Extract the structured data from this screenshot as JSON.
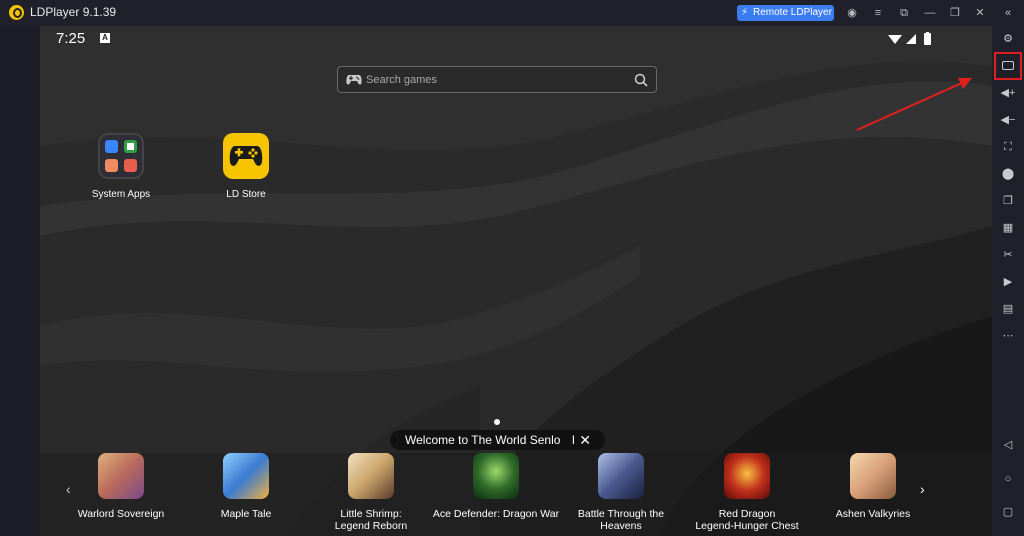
{
  "titlebar": {
    "app_title": "LDPlayer 9.1.39",
    "remote_button": "Remote LDPlayer",
    "icons": [
      "account-icon",
      "menu-icon",
      "fullscreen-icon",
      "minimize-icon",
      "restore-icon",
      "close-icon",
      "collapse-icon"
    ]
  },
  "statusbar": {
    "time": "7:25",
    "notification": "A"
  },
  "search": {
    "placeholder": "Search games"
  },
  "desktop": {
    "apps": [
      {
        "label": "System Apps"
      },
      {
        "label": "LD Store"
      }
    ]
  },
  "toast": {
    "text": "Welcome to The World Senlo",
    "cursor": "I"
  },
  "dock": {
    "games": [
      {
        "line1": "Warlord Sovereign",
        "line2": "",
        "color": "#b86a5a"
      },
      {
        "line1": "Maple Tale",
        "line2": "",
        "color": "#3a7bd0"
      },
      {
        "line1": "Little Shrimp:",
        "line2": "Legend Reborn",
        "color": "#c9a46a"
      },
      {
        "line1": "Ace Defender: Dragon War",
        "line2": "",
        "color": "#2f6a2a"
      },
      {
        "line1": "Battle Through the",
        "line2": "Heavens",
        "color": "#4a5a90"
      },
      {
        "line1": "Red Dragon",
        "line2": "Legend-Hunger Chest",
        "color": "#c0301c"
      },
      {
        "line1": "Ashen Valkyries",
        "line2": "",
        "color": "#d8a07a"
      }
    ]
  },
  "right_toolbar": {
    "icons": [
      "settings-icon",
      "keyboard-mapping-icon",
      "volume-up-icon",
      "volume-down-icon",
      "screenshot-icon",
      "install-apk-icon",
      "multi-instance-icon",
      "operation-record-icon",
      "scissors-icon",
      "video-record-icon",
      "shared-folder-icon",
      "more-icon",
      "back-icon",
      "home-icon",
      "recents-icon"
    ]
  },
  "colors": {
    "accent": "#3b7cf0",
    "highlight": "#e02020",
    "titlebar": "#1f2029",
    "ld_yellow": "#f6c400"
  }
}
